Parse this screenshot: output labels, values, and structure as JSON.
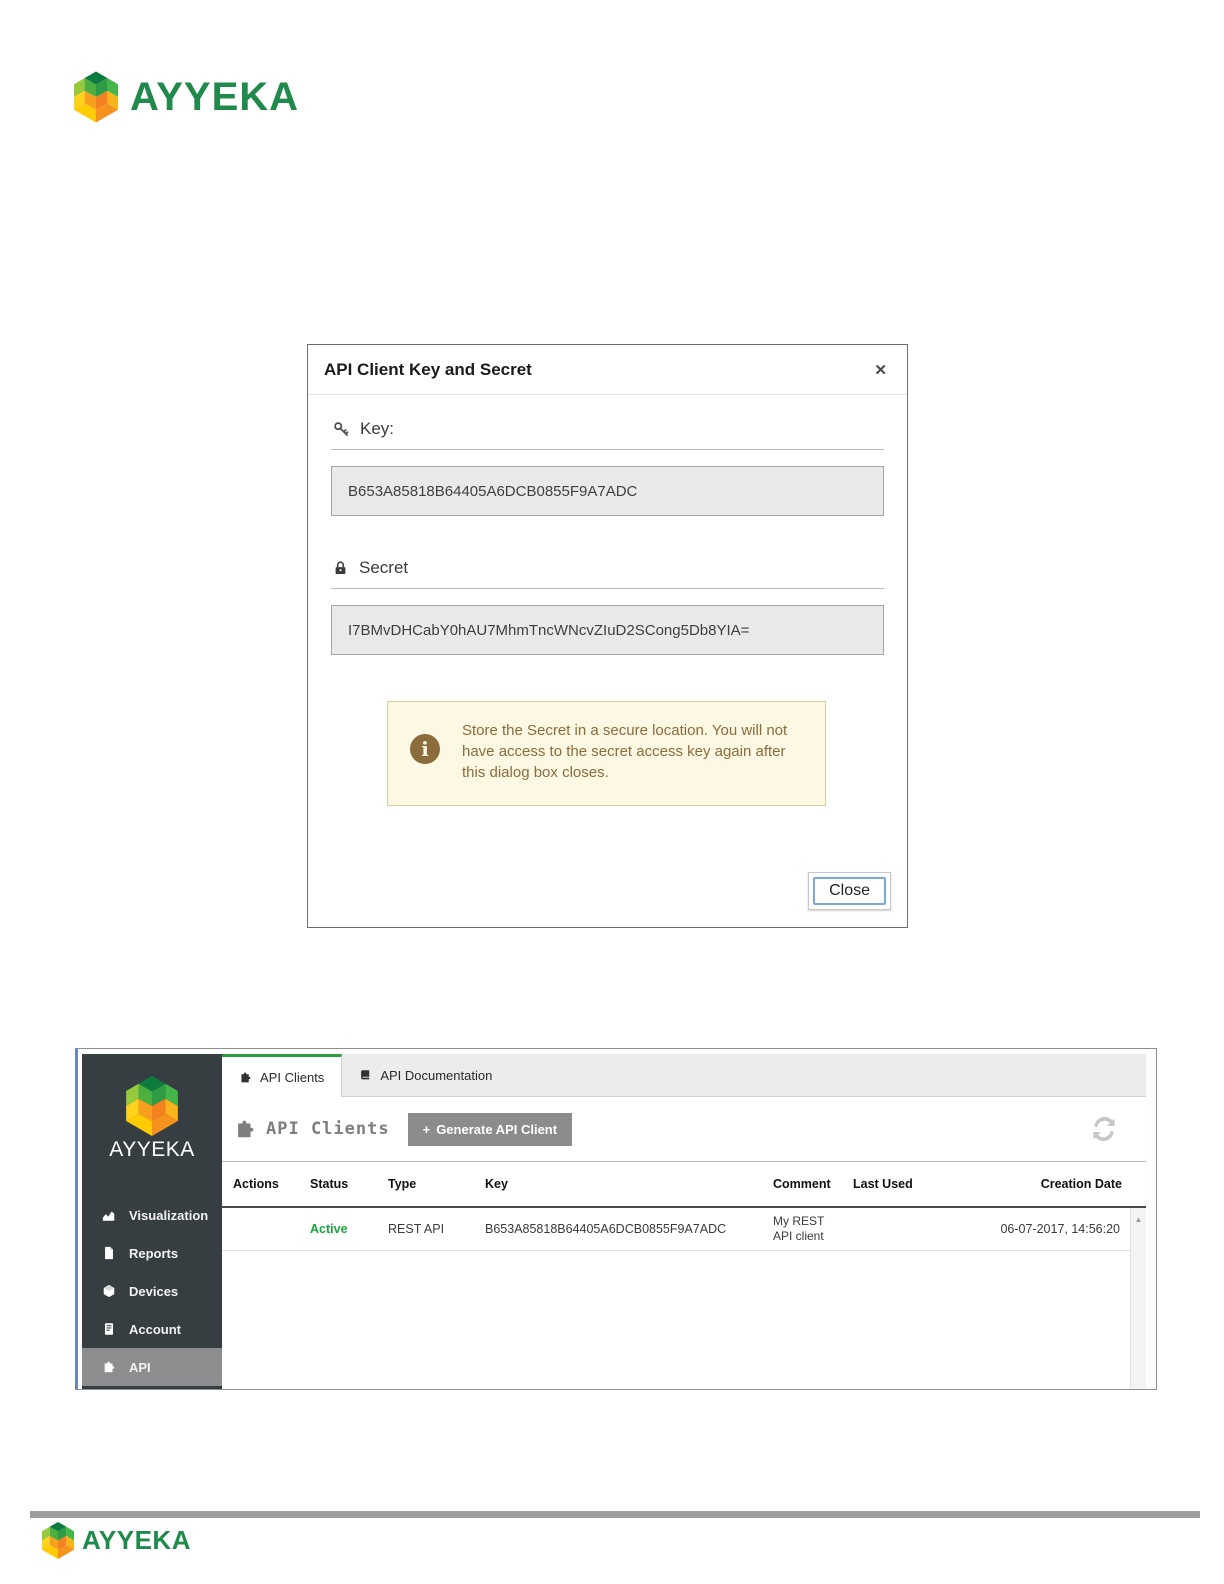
{
  "brand": {
    "name": "AYYEKA",
    "green": "#1f8a4b"
  },
  "dialog": {
    "title": "API Client Key and Secret",
    "close_icon_glyph": "✕",
    "key_label": "Key:",
    "key_value": "B653A85818B64405A6DCB0855F9A7ADC",
    "secret_label": "Secret",
    "secret_value": "I7BMvDHCabY0hAU7MhmTncWNcvZIuD2SCong5Db8YIA=",
    "info_icon_glyph": "i",
    "warning_text": "Store the Secret in a secure location. You will not have access to the secret access key again after this dialog box closes.",
    "close_button_label": "Close"
  },
  "app": {
    "sidebar": {
      "logo_text": "AYYEKA",
      "items": [
        {
          "label": "Visualization",
          "selected": false
        },
        {
          "label": "Reports",
          "selected": false
        },
        {
          "label": "Devices",
          "selected": false
        },
        {
          "label": "Account",
          "selected": false
        },
        {
          "label": "API",
          "selected": true
        }
      ]
    },
    "tabs": [
      {
        "label": "API Clients",
        "active": true
      },
      {
        "label": "API Documentation",
        "active": false
      }
    ],
    "toolbar": {
      "heading": "API Clients",
      "generate_plus_glyph": "+",
      "generate_button_label": "Generate API Client"
    },
    "table": {
      "columns": [
        "Actions",
        "Status",
        "Type",
        "Key",
        "Comment",
        "Last Used",
        "Creation Date"
      ],
      "rows": [
        {
          "actions": "",
          "status": "Active",
          "type": "REST API",
          "key": "B653A85818B64405A6DCB0855F9A7ADC",
          "comment": "My REST API client",
          "last_used": "",
          "creation_date": "06-07-2017, 14:56:20"
        }
      ]
    },
    "scroll_up_glyph": "▲"
  },
  "colors": {
    "sidebar_bg": "#363e41",
    "sidebar_selected_bg": "#8b8d8e",
    "tab_active_accent": "#2e9b3d",
    "status_active_green": "#18a63c",
    "warning_bg": "#fcf8e3",
    "warning_text": "#8a6d3b",
    "generate_button_gray": "#8c8c8c"
  }
}
